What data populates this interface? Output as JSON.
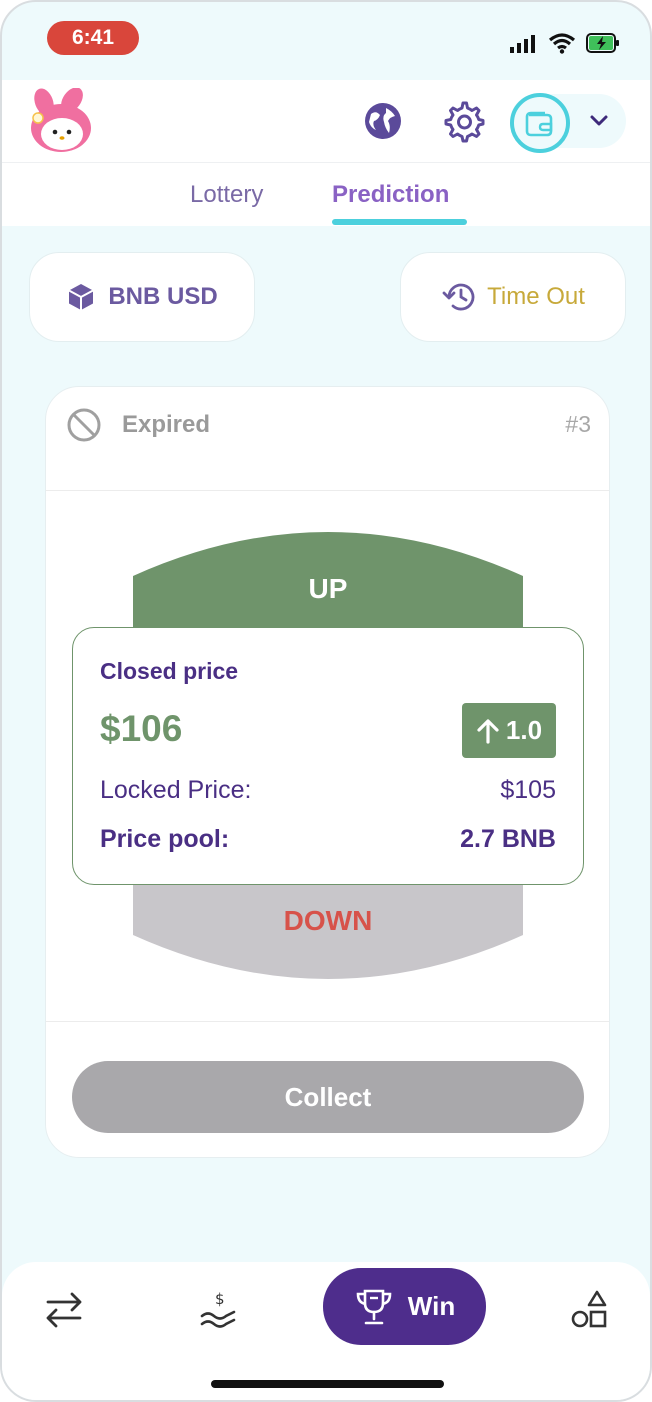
{
  "status_bar": {
    "time": "6:41",
    "icons": [
      "signal-icon",
      "wifi-icon",
      "battery-charging-icon"
    ]
  },
  "header": {
    "logo": "melody-logo",
    "icons": [
      "globe-icon",
      "gear-icon",
      "wallet-icon",
      "chevron-down-icon"
    ]
  },
  "tabs": [
    {
      "label": "Lottery",
      "active": false
    },
    {
      "label": "Prediction",
      "active": true
    }
  ],
  "pair_pill": {
    "label": "BNB USD",
    "icon": "cube-icon"
  },
  "status_pill": {
    "label": "Time Out",
    "icon": "history-icon"
  },
  "card": {
    "status": "Expired",
    "round": "#3",
    "up_label": "UP",
    "down_label": "DOWN",
    "closed_title": "Closed price",
    "closed_value": "$106",
    "change": "1.0",
    "locked_label": "Locked Price:",
    "locked_value": "$105",
    "pool_label": "Price pool:",
    "pool_value": "2.7 BNB",
    "collect_label": "Collect"
  },
  "bottom_nav": {
    "items": [
      "swap-icon",
      "earn-icon",
      "trophy-icon",
      "shapes-icon"
    ],
    "win_label": "Win"
  },
  "colors": {
    "accent": "#4cd0dd",
    "primary": "#4e2d8c",
    "up": "#6f946b",
    "down": "#d7524a",
    "muted": "#a9a8ab"
  }
}
